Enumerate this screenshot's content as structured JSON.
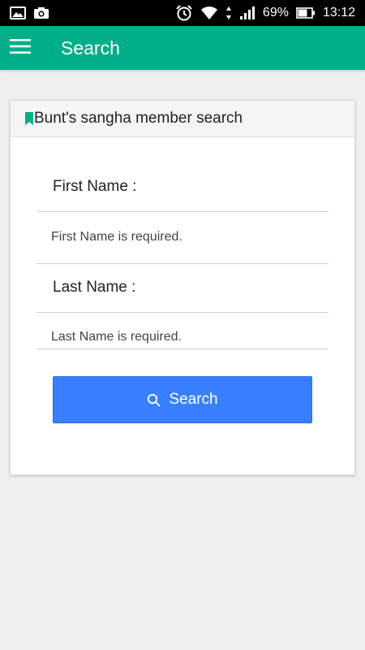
{
  "status_bar": {
    "battery_percent": "69%",
    "time": "13:12",
    "icons": [
      "image-icon",
      "camera-icon",
      "alarm-icon",
      "wifi-icon",
      "data-arrows-icon",
      "signal-icon",
      "battery-icon"
    ]
  },
  "app_bar": {
    "title": "Search",
    "menu_icon": "hamburger-menu-icon",
    "color": "#00ae88"
  },
  "card": {
    "title": "Bunt's sangha member search",
    "bookmark_icon": "bookmark-icon",
    "first_name": {
      "label": "First Name :",
      "error": "First Name is required."
    },
    "last_name": {
      "label": "Last Name :",
      "error": "Last Name is required."
    },
    "search_button": {
      "label": "Search",
      "icon": "search-icon",
      "color": "#3880ff"
    }
  }
}
